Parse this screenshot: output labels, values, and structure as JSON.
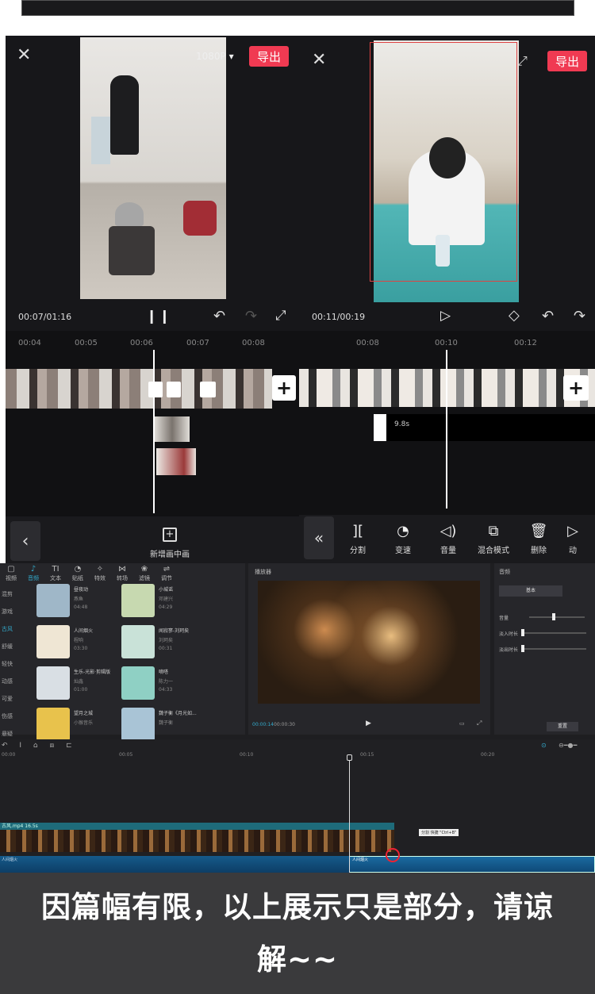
{
  "left_editor": {
    "resolution": "1080P",
    "export_label": "导出",
    "time": "00:07/01:16",
    "ticks": [
      "00:04",
      "00:05",
      "00:06",
      "00:07",
      "00:08"
    ],
    "bottom_action": "新增画中画"
  },
  "right_editor": {
    "export_label": "导出",
    "time": "00:11/00:19",
    "ticks": [
      "00:08",
      "00:10",
      "00:12"
    ],
    "audio_duration": "9.8s",
    "tools": [
      {
        "icon": "split-icon",
        "glyph": "][",
        "label": "分割"
      },
      {
        "icon": "speed-icon",
        "glyph": "◔",
        "label": "变速"
      },
      {
        "icon": "volume-icon",
        "glyph": "◁)",
        "label": "音量"
      },
      {
        "icon": "blend-icon",
        "glyph": "⧉",
        "label": "混合模式"
      },
      {
        "icon": "delete-icon",
        "glyph": "🗑",
        "label": "删除"
      },
      {
        "icon": "animation-icon",
        "glyph": "▷",
        "label": "动"
      }
    ]
  },
  "desktop": {
    "top_tabs": [
      {
        "glyph": "▢",
        "label": "视频"
      },
      {
        "glyph": "♪",
        "label": "音频"
      },
      {
        "glyph": "TI",
        "label": "文本"
      },
      {
        "glyph": "◔",
        "label": "贴纸"
      },
      {
        "glyph": "✧",
        "label": "特效"
      },
      {
        "glyph": "⋈",
        "label": "转场"
      },
      {
        "glyph": "❀",
        "label": "滤镜"
      },
      {
        "glyph": "⇌",
        "label": "调节"
      }
    ],
    "categories": [
      "混剪",
      "游戏",
      "古风",
      "舒缓",
      "轻快",
      "动感",
      "可爱",
      "伤感",
      "悬疑"
    ],
    "music": [
      {
        "title": "昼夜动",
        "artist": "燕鱼",
        "duration": "04:48",
        "color": "#9fb7c8"
      },
      {
        "title": "小城谣",
        "artist": "邓建兴",
        "duration": "04:29",
        "color": "#c7d9b0"
      },
      {
        "title": "人间烟火",
        "artist": "程响",
        "duration": "03:30",
        "color": "#efe6d4"
      },
      {
        "title": "闻寂寥-刘珂矣",
        "artist": "刘珂矣",
        "duration": "00:31",
        "color": "#c9e2d8"
      },
      {
        "title": "生乐-光影·剪辑版",
        "artist": "灿鑫",
        "duration": "01:00",
        "color": "#d9dfe4"
      },
      {
        "title": "嘀嗒",
        "artist": "陈力一",
        "duration": "04:33",
        "color": "#8fd0c4"
      },
      {
        "title": "望月之城",
        "artist": "小猴音乐",
        "duration": "",
        "color": "#e8c24c"
      },
      {
        "title": "魏子衡《月光如...",
        "artist": "魏子衡",
        "duration": "",
        "color": "#a9c4d6"
      }
    ],
    "player_label": "播放器",
    "player_time": "00:00:14",
    "player_total": "00:00:30",
    "props_label": "音频",
    "props_tab": "基本",
    "props_rows": [
      "音量",
      "淡入时长",
      "淡出时长"
    ],
    "reset_label": "重置",
    "timeline_ticks": [
      "00:00",
      "00:05",
      "00:10",
      "00:15",
      "00:20"
    ],
    "video_clip": "古风.mp4  16.5s",
    "audio_clip_a": "人间烟火",
    "audio_clip_b": "人间烟火",
    "tooltip": "分割 快捷 \"Ctrl+B\""
  },
  "caption": "因篇幅有限，以上展示只是部分，请谅解~~"
}
